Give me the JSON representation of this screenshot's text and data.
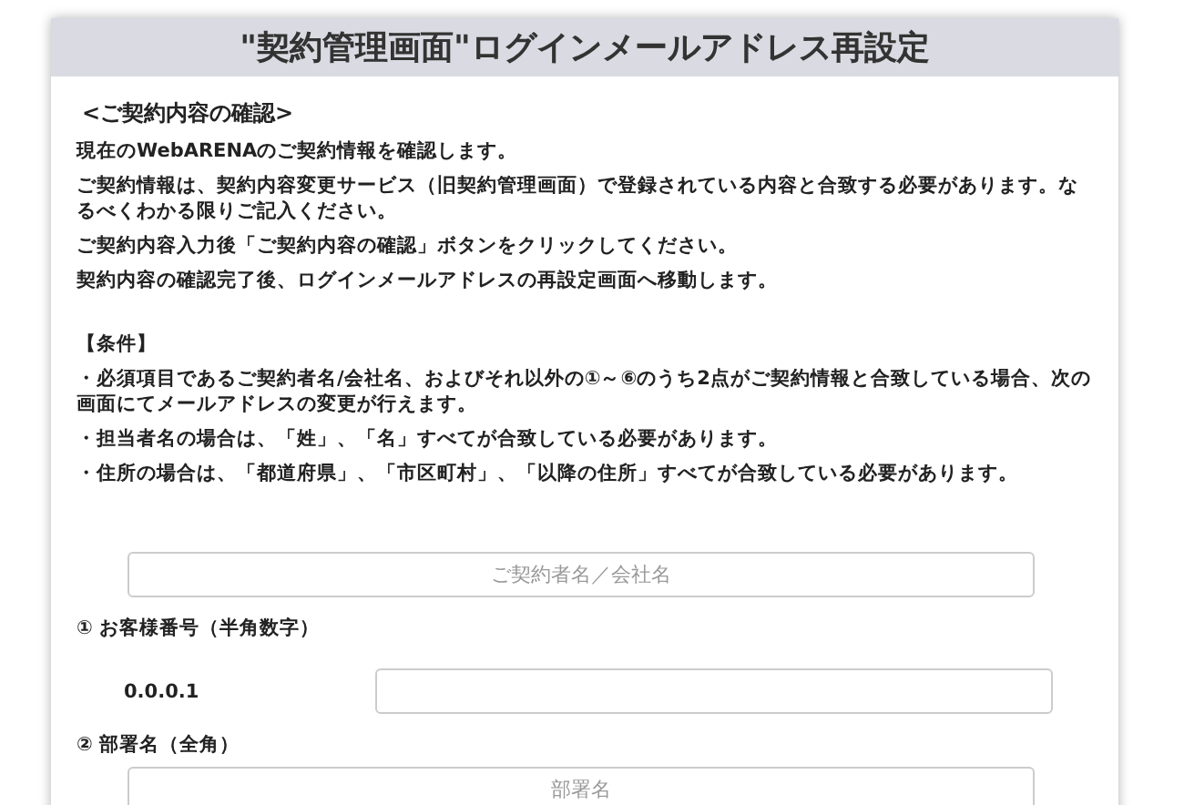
{
  "title": "\"契約管理画面\"ログインメールアドレス再設定",
  "confirmation": {
    "heading": "<ご契約内容の確認>",
    "paragraphs": [
      "現在のWebARENAのご契約情報を確認します。",
      "ご契約情報は、契約内容変更サービス（旧契約管理画面）で登録されている内容と合致する必要があります。なるべくわかる限りご記入ください。",
      "ご契約内容入力後「ご契約内容の確認」ボタンをクリックしてください。",
      "契約内容の確認完了後、ログインメールアドレスの再設定画面へ移動します。"
    ]
  },
  "conditions": {
    "heading": "【条件】",
    "items": [
      "・必須項目であるご契約者名/会社名、およびそれ以外の①～⑥のうち2点がご契約情報と合致している場合、次の画面にてメールアドレスの変更が行えます。",
      "・担当者名の場合は、「姓」、「名」すべてが合致している必要があります。",
      "・住所の場合は、「都道府県」、「市区町村」、「以降の住所」すべてが合致している必要があります。"
    ]
  },
  "form": [
    {
      "kind": "field",
      "placeholder": "ご契約者名／会社名"
    },
    {
      "kind": "label",
      "text": "① お客様番号（半角数字）"
    },
    {
      "kind": "prefixed-field",
      "prefix": "0.0.0.1"
    },
    {
      "kind": "label",
      "text": "② 部署名（全角）"
    },
    {
      "kind": "field",
      "placeholder": "部署名"
    }
  ]
}
